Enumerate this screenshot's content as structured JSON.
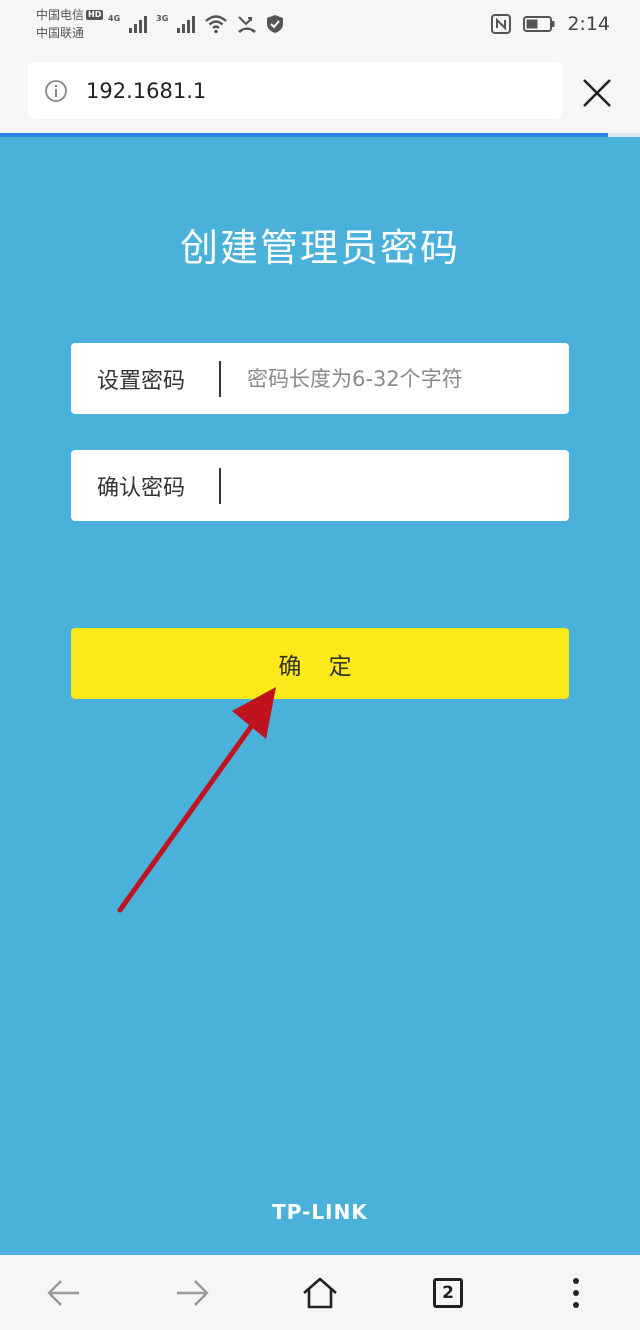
{
  "status_bar": {
    "carrier_1": "中国电信",
    "carrier_1_badge": "HD",
    "carrier_2": "中国联通",
    "net_1": "4G",
    "net_2": "3G",
    "time": "2:14",
    "icons": [
      "signal-icon",
      "wifi-icon",
      "missed-call-icon",
      "shield-icon",
      "nfc-icon",
      "battery-icon"
    ]
  },
  "browser": {
    "url": "192.1681.1",
    "info_icon": "info-icon",
    "close_icon": "close-icon",
    "accent_color": "#2e86e0"
  },
  "page": {
    "title": "创建管理员密码",
    "background_color": "#4ab1da",
    "set_password": {
      "label": "设置密码",
      "value": "",
      "placeholder": "密码长度为6-32个字符"
    },
    "confirm_password": {
      "label": "确认密码",
      "value": "",
      "placeholder": ""
    },
    "confirm_button": {
      "label": "确 定",
      "color": "#fbe919"
    },
    "annotation_arrow_color": "#c0121f",
    "brand": "TP-LINK"
  },
  "bottom_nav": {
    "tab_count": "2",
    "icons": [
      "back-arrow-icon",
      "forward-arrow-icon",
      "home-icon",
      "tabs-icon",
      "more-icon"
    ]
  }
}
